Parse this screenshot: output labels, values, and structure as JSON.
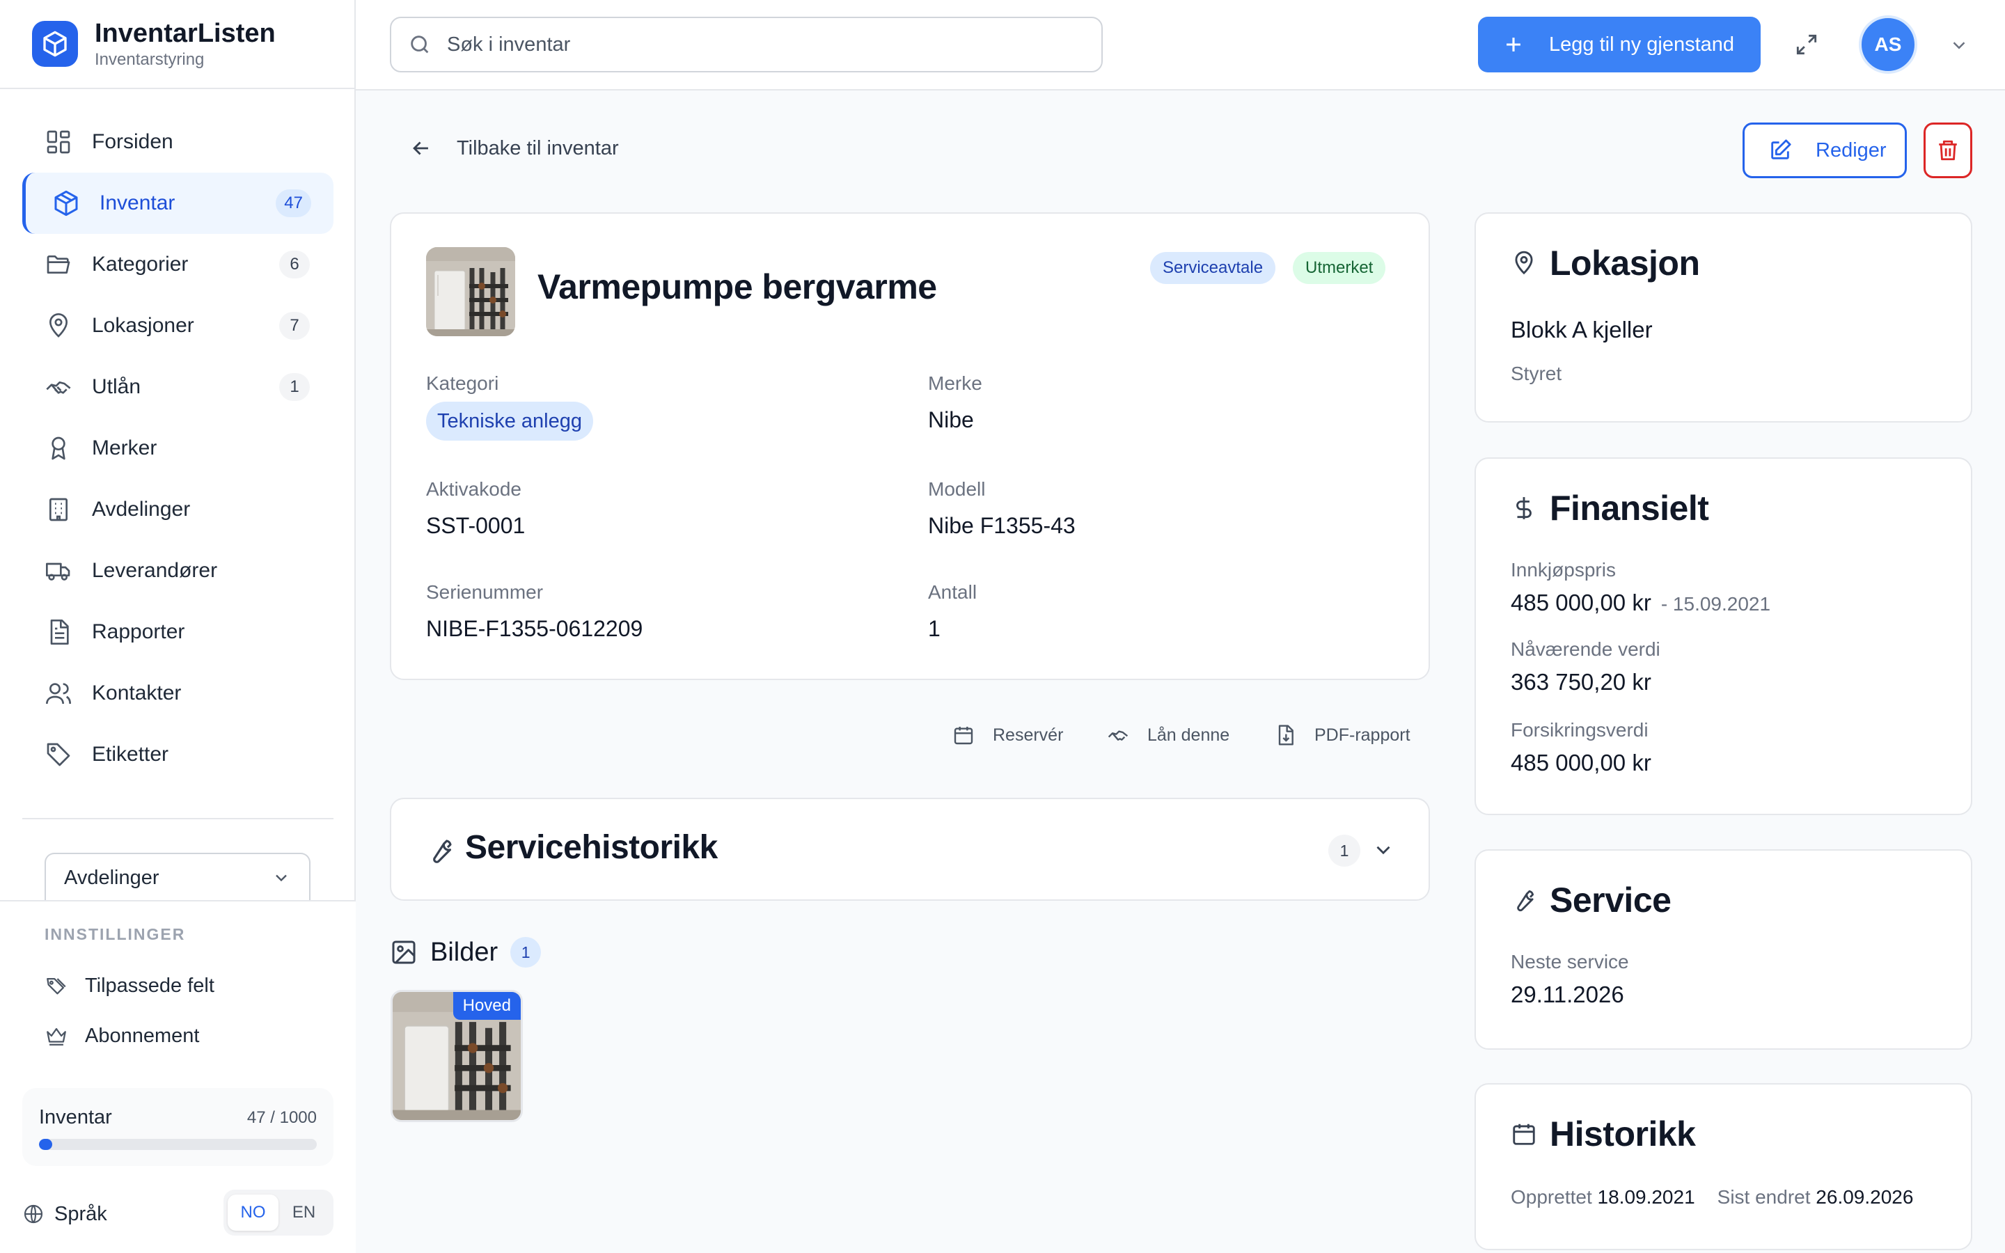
{
  "app": {
    "title": "InventarListen",
    "subtitle": "Inventarstyring",
    "accent": "#2563eb"
  },
  "sidebar": {
    "items": [
      {
        "label": "Forsiden",
        "icon": "grid-icon",
        "count": null
      },
      {
        "label": "Inventar",
        "icon": "box-icon",
        "count": "47",
        "active": true
      },
      {
        "label": "Kategorier",
        "icon": "folder-icon",
        "count": "6"
      },
      {
        "label": "Lokasjoner",
        "icon": "map-pin-icon",
        "count": "7"
      },
      {
        "label": "Utlån",
        "icon": "handshake-icon",
        "count": "1"
      },
      {
        "label": "Merker",
        "icon": "award-icon",
        "count": null
      },
      {
        "label": "Avdelinger",
        "icon": "building-icon",
        "count": null
      },
      {
        "label": "Leverandører",
        "icon": "truck-icon",
        "count": null
      },
      {
        "label": "Rapporter",
        "icon": "file-text-icon",
        "count": null
      },
      {
        "label": "Kontakter",
        "icon": "users-icon",
        "count": null
      },
      {
        "label": "Etiketter",
        "icon": "tag-icon",
        "count": null
      }
    ],
    "department_select": "Avdelinger",
    "settings": {
      "heading": "INNSTILLINGER",
      "items": [
        {
          "label": "Tilpassede felt",
          "icon": "tags-icon"
        },
        {
          "label": "Abonnement",
          "icon": "crown-icon"
        }
      ]
    },
    "usage": {
      "label": "Inventar",
      "value": "47 / 1000",
      "fraction": 0.047
    },
    "language": {
      "label": "Språk",
      "options": [
        "NO",
        "EN"
      ],
      "selected": "NO"
    }
  },
  "topbar": {
    "search_placeholder": "Søk i inventar",
    "add_button": "Legg til ny gjenstand",
    "avatar_initials": "AS"
  },
  "page": {
    "back_label": "Tilbake til inventar",
    "edit_label": "Rediger"
  },
  "item": {
    "title": "Varmepumpe bergvarme",
    "tags": [
      "Serviceavtale",
      "Utmerket"
    ],
    "fields": {
      "kategori": {
        "label": "Kategori",
        "value": "Tekniske anlegg"
      },
      "merke": {
        "label": "Merke",
        "value": "Nibe"
      },
      "aktivakode": {
        "label": "Aktivakode",
        "value": "SST-0001"
      },
      "modell": {
        "label": "Modell",
        "value": "Nibe F1355-43"
      },
      "serienummer": {
        "label": "Serienummer",
        "value": "NIBE-F1355-0612209"
      },
      "antall": {
        "label": "Antall",
        "value": "1"
      }
    },
    "actions": [
      "Reservér",
      "Lån denne",
      "PDF-rapport"
    ]
  },
  "service_history": {
    "title": "Servicehistorikk",
    "count": "1"
  },
  "images": {
    "title": "Bilder",
    "count": "1",
    "main_label": "Hoved"
  },
  "location_card": {
    "title": "Lokasjon",
    "place": "Blokk A kjeller",
    "owner": "Styret"
  },
  "finance_card": {
    "title": "Finansielt",
    "purchase_label": "Innkjøpspris",
    "purchase_value": "485 000,00 kr",
    "purchase_date": "- 15.09.2021",
    "current_label": "Nåværende verdi",
    "current_value": "363 750,20 kr",
    "insurance_label": "Forsikringsverdi",
    "insurance_value": "485 000,00 kr"
  },
  "service_card": {
    "title": "Service",
    "next_label": "Neste service",
    "next_value": "29.11.2026"
  },
  "history_card": {
    "title": "Historikk",
    "created_label": "Opprettet",
    "created_value": "18.09.2021",
    "changed_label": "Sist endret",
    "changed_value": "26.09.2026"
  }
}
